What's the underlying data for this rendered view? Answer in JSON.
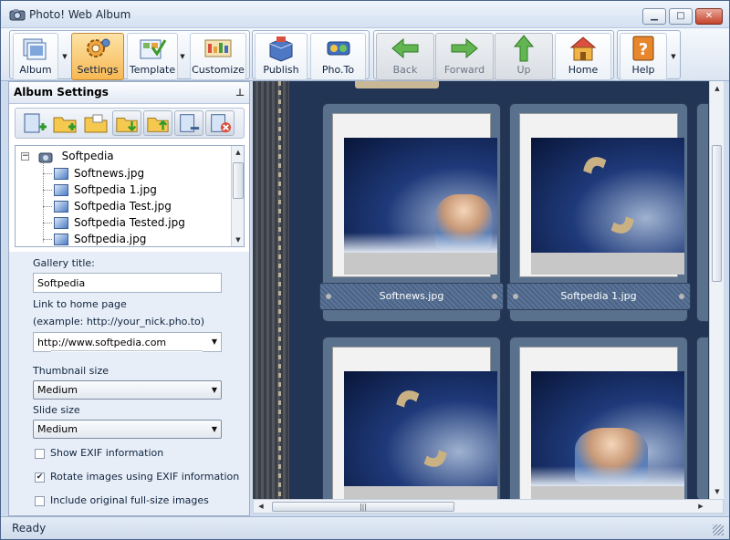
{
  "window": {
    "title": "Photo! Web Album",
    "minimize": "▁",
    "maximize": "□",
    "close": "✕"
  },
  "toolbar": {
    "album": "Album",
    "settings": "Settings",
    "template": "Template",
    "customize": "Customize",
    "publish": "Publish",
    "phto": "Pho.To",
    "back": "Back",
    "forward": "Forward",
    "up": "Up",
    "home": "Home",
    "help": "Help"
  },
  "panel": {
    "title": "Album Settings",
    "tree": {
      "root": "Softpedia",
      "files": [
        "Softnews.jpg",
        "Softpedia 1.jpg",
        "Softpedia Test.jpg",
        "Softpedia Tested.jpg",
        "Softpedia.jpg"
      ]
    },
    "form": {
      "gallery_title_label": "Gallery title:",
      "gallery_title_value": "Softpedia",
      "link_label": "Link to home page",
      "link_example": "(example: http://your_nick.pho.to)",
      "link_value": "http://www.softpedia.com",
      "thumb_label": "Thumbnail size",
      "thumb_value": "Medium",
      "slide_label": "Slide size",
      "slide_value": "Medium",
      "show_exif": "Show EXIF information",
      "show_exif_checked": false,
      "rotate_exif": "Rotate images using EXIF information",
      "rotate_exif_checked": true,
      "include_original": "Include original full-size images",
      "include_original_checked": false
    }
  },
  "preview": {
    "cards": [
      "Softnews.jpg",
      "Softpedia 1.jpg",
      "",
      ""
    ]
  },
  "status": {
    "text": "Ready"
  },
  "colors": {
    "accent": "#f7b852",
    "frame": "#4a6389",
    "album_bg": "#223554"
  }
}
